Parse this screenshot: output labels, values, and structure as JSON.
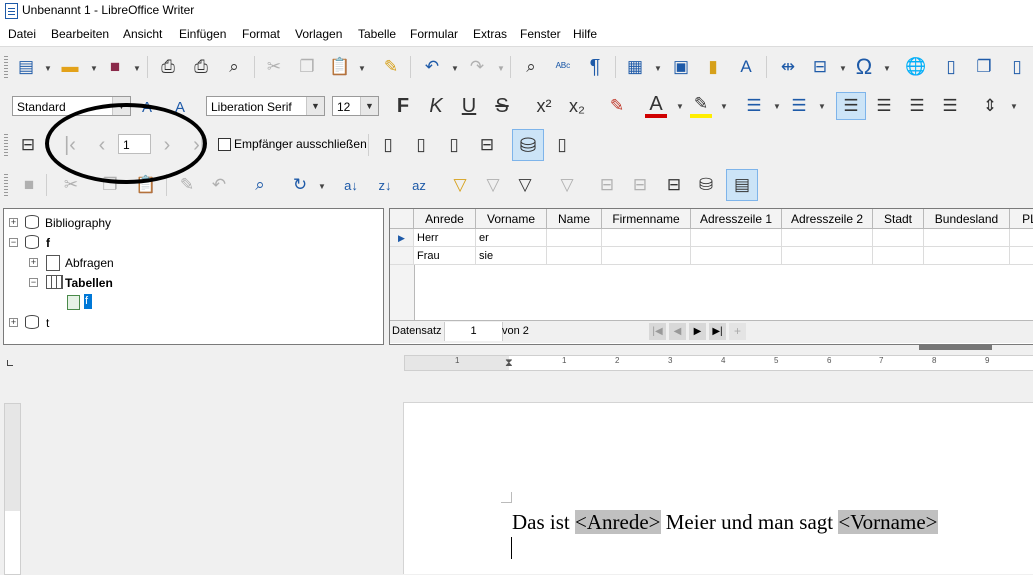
{
  "window": {
    "title": "Unbenannt 1 - LibreOffice Writer"
  },
  "menu": [
    "Datei",
    "Bearbeiten",
    "Ansicht",
    "Einfügen",
    "Format",
    "Vorlagen",
    "Tabelle",
    "Formular",
    "Extras",
    "Fenster",
    "Hilfe"
  ],
  "format_bar": {
    "paragraph_style": "Standard",
    "font_name": "Liberation Serif",
    "font_size": "12"
  },
  "mailmerge_bar": {
    "record_value": "1",
    "exclude_label": "Empfänger ausschließen"
  },
  "explorer": {
    "items": [
      {
        "label": "Bibliography",
        "level": 0,
        "expander": "+"
      },
      {
        "label": "f",
        "level": 0,
        "expander": "−"
      },
      {
        "label": "Abfragen",
        "level": 1,
        "expander": "+"
      },
      {
        "label": "Tabellen",
        "level": 1,
        "expander": "−"
      },
      {
        "label": "f",
        "level": 2,
        "selected": true
      },
      {
        "label": "t",
        "level": 0,
        "expander": "+"
      }
    ]
  },
  "grid": {
    "columns": [
      "Anrede",
      "Vorname",
      "Name",
      "Firmenname",
      "Adresszeile 1",
      "Adresszeile 2",
      "Stadt",
      "Bundesland",
      "PL"
    ],
    "rows": [
      [
        "Herr",
        "er"
      ],
      [
        "Frau",
        "sie"
      ]
    ],
    "nav": {
      "label": "Datensatz",
      "current": "1",
      "total_text": "von 2"
    }
  },
  "ruler_numbers": [
    "1",
    "1",
    "2",
    "3",
    "4",
    "5",
    "6",
    "7",
    "8",
    "9"
  ],
  "document": {
    "text_before": "Das ist ",
    "field1": "<Anrede>",
    "text_middle": " Meier und man sagt ",
    "field2": "<Vorname>"
  },
  "colors": {
    "accent": "#1e5aa8",
    "selection": "#0078d7",
    "field_shade": "#c0c0c0"
  }
}
